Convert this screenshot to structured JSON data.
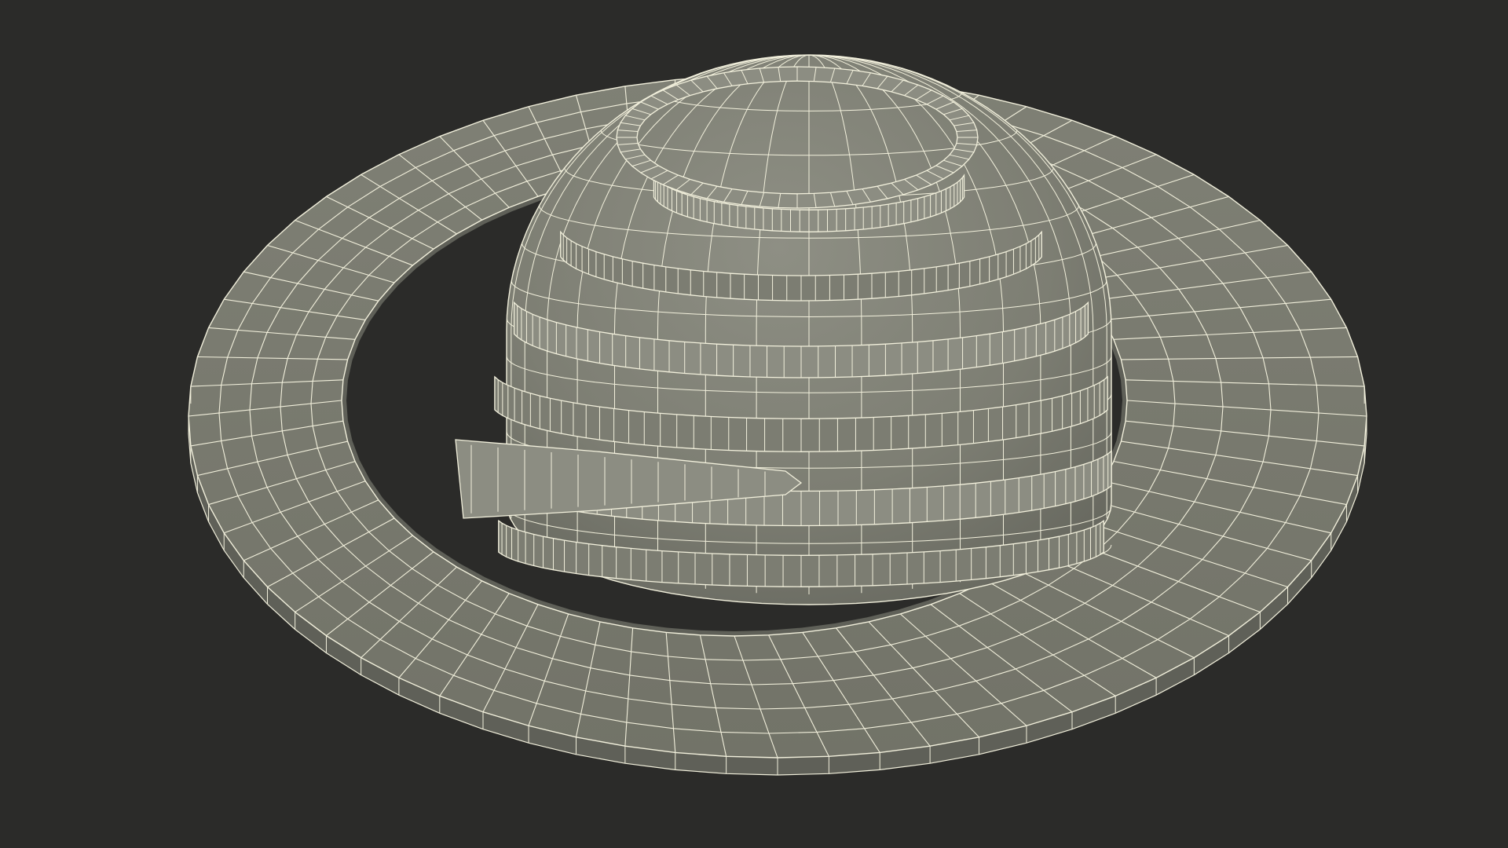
{
  "scene": {
    "subject": "wireframe-hat-model",
    "colors": {
      "background": "#2b2b29",
      "surface": "#7c7d72",
      "surface_light": "#8c8d82",
      "surface_dark": "#5f6058",
      "wire": "#f2f0dc",
      "hole": "#2b2b29"
    }
  }
}
